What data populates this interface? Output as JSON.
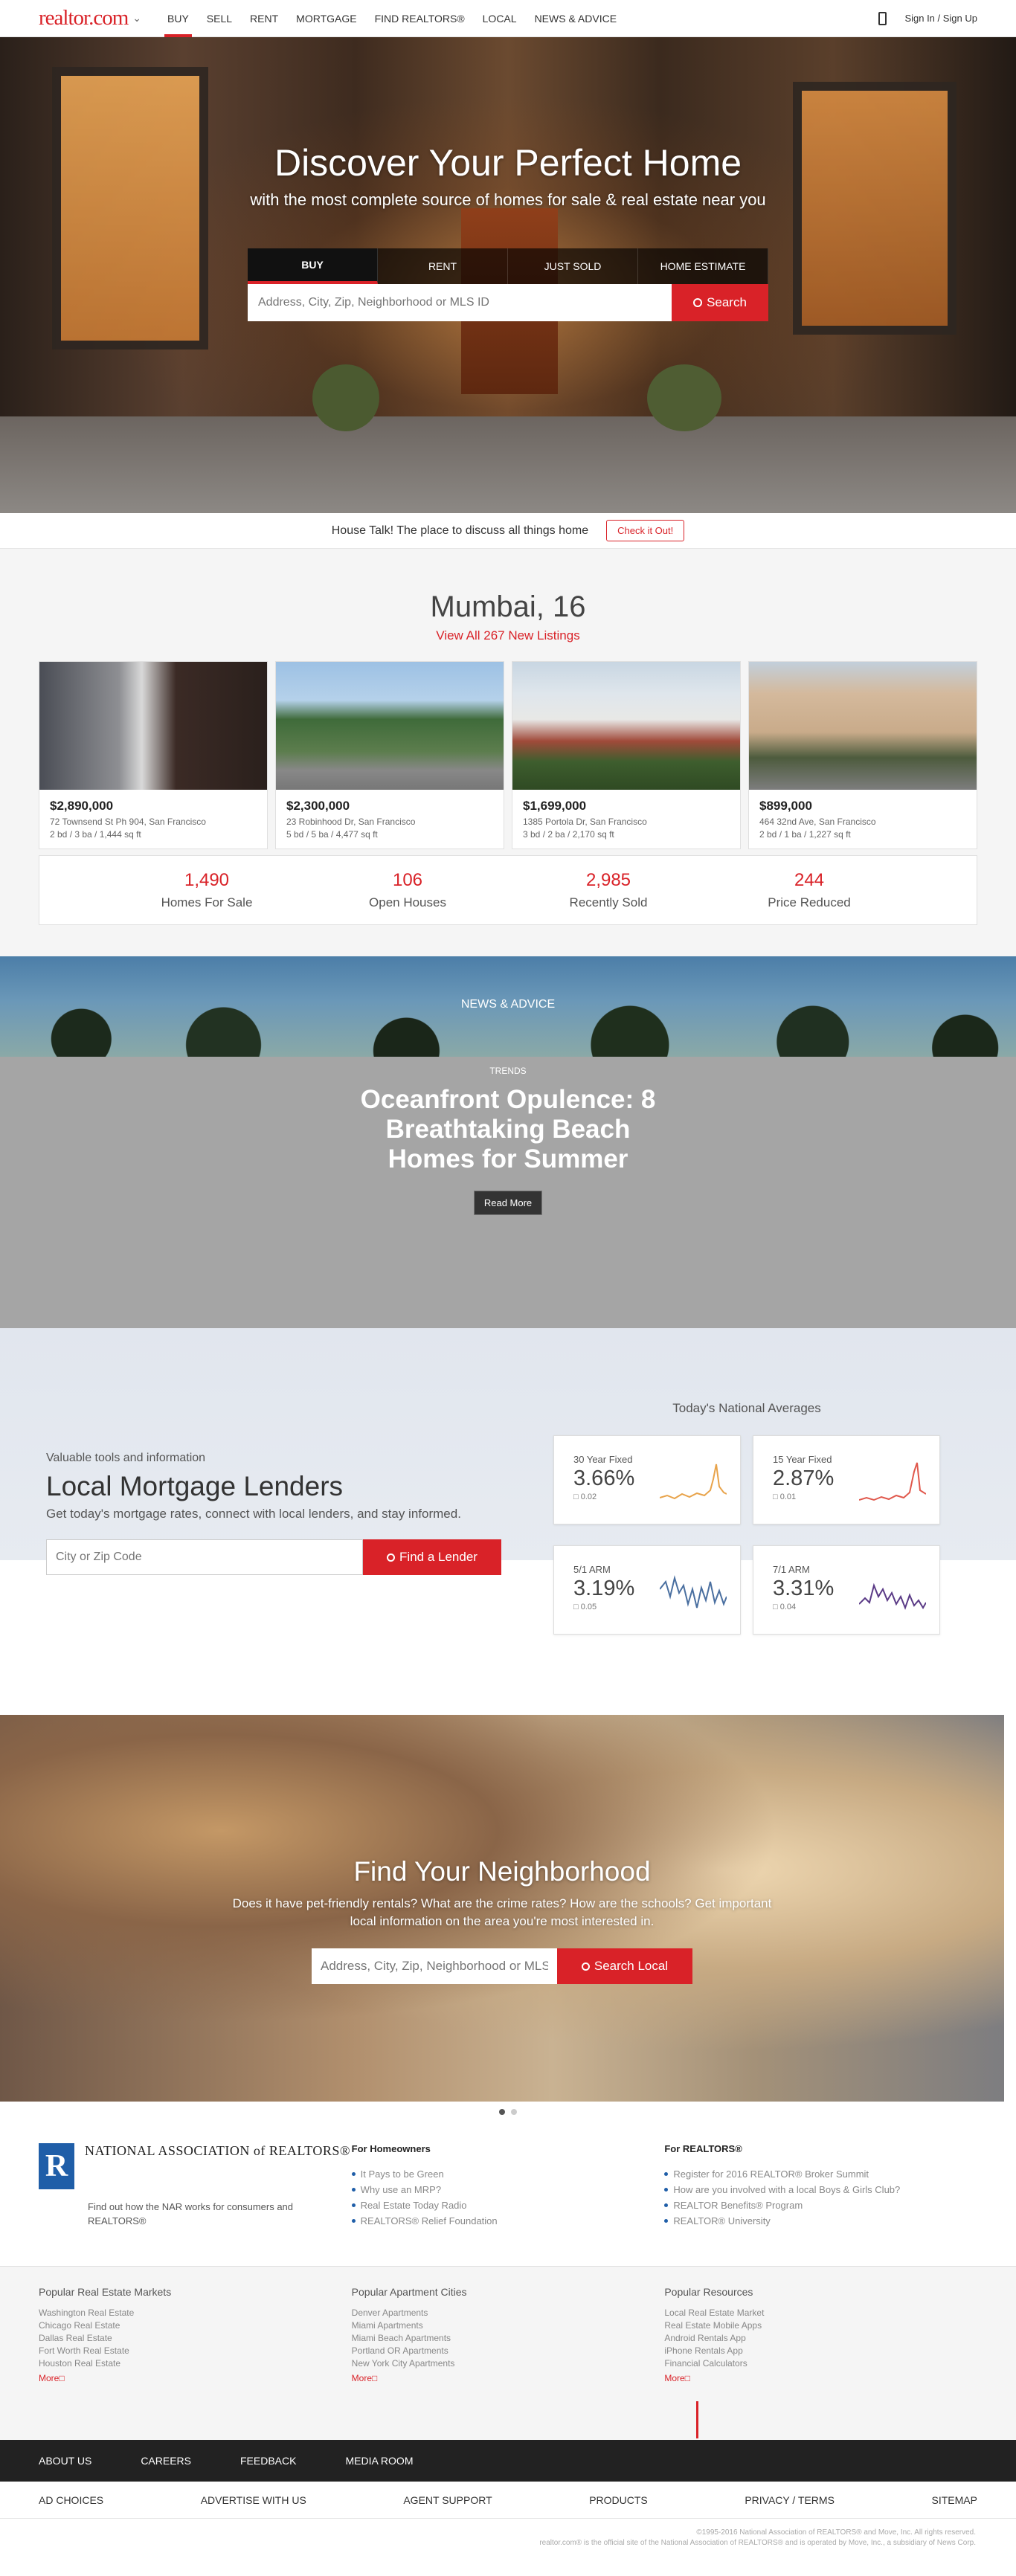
{
  "nav": {
    "logo": "realtor.com",
    "items": [
      "BUY",
      "SELL",
      "RENT",
      "MORTGAGE",
      "FIND REALTORS®",
      "LOCAL",
      "NEWS & ADVICE"
    ],
    "signin": "Sign In / Sign Up"
  },
  "hero": {
    "title": "Discover Your Perfect Home",
    "subtitle": "with the most complete source of homes for sale & real estate near you",
    "tabs": [
      "BUY",
      "RENT",
      "JUST SOLD",
      "HOME ESTIMATE"
    ],
    "search_placeholder": "Address, City, Zip, Neighborhood or MLS ID",
    "search_button": "Search"
  },
  "housetalk": {
    "text": "House Talk! The place to discuss all things home",
    "button": "Check it Out!"
  },
  "listings": {
    "city": "Mumbai, 16",
    "view_all": "View All 267 New Listings",
    "cards": [
      {
        "price": "$2,890,000",
        "address": "72 Townsend St Ph 904, San Francisco",
        "meta": "2 bd / 3 ba / 1,444 sq ft"
      },
      {
        "price": "$2,300,000",
        "address": "23 Robinhood Dr, San Francisco",
        "meta": "5 bd / 5 ba / 4,477 sq ft"
      },
      {
        "price": "$1,699,000",
        "address": "1385 Portola Dr, San Francisco",
        "meta": "3 bd / 2 ba / 2,170 sq ft"
      },
      {
        "price": "$899,000",
        "address": "464 32nd Ave, San Francisco",
        "meta": "2 bd / 1 ba / 1,227 sq ft"
      }
    ],
    "stats": [
      {
        "num": "1,490",
        "label": "Homes For Sale"
      },
      {
        "num": "106",
        "label": "Open Houses"
      },
      {
        "num": "2,985",
        "label": "Recently Sold"
      },
      {
        "num": "244",
        "label": "Price Reduced"
      }
    ]
  },
  "news": {
    "label": "NEWS & ADVICE",
    "category": "TRENDS",
    "headline": "Oceanfront Opulence: 8 Breathtaking Beach Homes for Summer",
    "button": "Read More"
  },
  "mortgage": {
    "eyebrow": "Valuable tools and information",
    "title": "Local Mortgage Lenders",
    "desc": "Get today's mortgage rates, connect with local lenders, and stay informed.",
    "placeholder": "City or Zip Code",
    "button": "Find a Lender",
    "averages_title": "Today's National Averages",
    "rates": [
      {
        "name": "30 Year Fixed",
        "value": "3.66%",
        "change": "0.02",
        "color": "#e8a34a"
      },
      {
        "name": "15 Year Fixed",
        "value": "2.87%",
        "change": "0.01",
        "color": "#e0584c"
      },
      {
        "name": "5/1 ARM",
        "value": "3.19%",
        "change": "0.05",
        "color": "#4a6fa0"
      },
      {
        "name": "7/1 ARM",
        "value": "3.31%",
        "change": "0.04",
        "color": "#5a3a86"
      }
    ]
  },
  "neighborhood": {
    "title": "Find Your Neighborhood",
    "desc": "Does it have pet-friendly rentals? What are the crime rates? How are the schools? Get important local information on the area you're most interested in.",
    "placeholder": "Address, City, Zip, Neighborhood or MLS ID",
    "button": "Search Local"
  },
  "footer": {
    "nar_name": "NATIONAL ASSOCIATION of REALTORS®",
    "nar_desc": "Find out how the NAR works for consumers and REALTORS®",
    "homeowners_title": "For Homeowners",
    "homeowners": [
      "It Pays to be Green",
      "Why use an MRP?",
      "Real Estate Today Radio",
      "REALTORS® Relief Foundation"
    ],
    "realtors_title": "For REALTORS®",
    "realtors": [
      "Register for 2016 REALTOR® Broker Summit",
      "How are you involved with a local Boys & Girls Club?",
      "REALTOR Benefits® Program",
      "REALTOR® University"
    ],
    "markets_title": "Popular Real Estate Markets",
    "markets": [
      "Washington Real Estate",
      "Chicago Real Estate",
      "Dallas Real Estate",
      "Fort Worth Real Estate",
      "Houston Real Estate"
    ],
    "apartments_title": "Popular Apartment Cities",
    "apartments": [
      "Denver Apartments",
      "Miami Apartments",
      "Miami Beach Apartments",
      "Portland OR Apartments",
      "New York City Apartments"
    ],
    "resources_title": "Popular Resources",
    "resources": [
      "Local Real Estate Market",
      "Real Estate Mobile Apps",
      "Android Rentals App",
      "iPhone Rentals App",
      "Financial Calculators"
    ],
    "more": "More",
    "bar1": [
      "ABOUT US",
      "CAREERS",
      "FEEDBACK",
      "MEDIA ROOM"
    ],
    "bar2": [
      "AD CHOICES",
      "ADVERTISE WITH US",
      "AGENT SUPPORT",
      "PRODUCTS",
      "PRIVACY / TERMS",
      "SITEMAP"
    ],
    "copyright1": "©1995-2016 National Association of REALTORS® and Move, Inc. All rights reserved.",
    "copyright2": "realtor.com® is the official site of the National Association of REALTORS® and is operated by Move, Inc., a subsidiary of News Corp."
  }
}
